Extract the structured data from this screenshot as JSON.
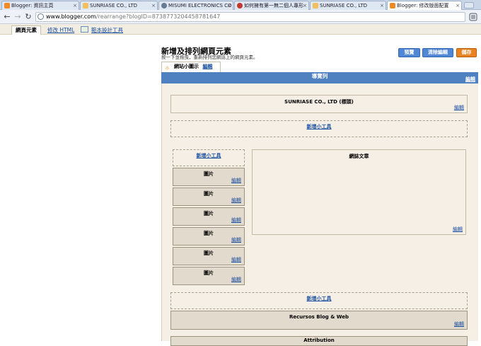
{
  "browser": {
    "tabs": [
      {
        "label": "Blogger: 資訊主頁",
        "color": "#f08a24"
      },
      {
        "label": "SUNRIASE CO., LTD",
        "color": "#f0c060"
      },
      {
        "label": "MISUMI ELECTRONICS CO",
        "color": "#6a7c93"
      },
      {
        "label": "如何擁有第一無二個人專形",
        "color": "#c0392b"
      },
      {
        "label": "SUNRIASE CO., LTD",
        "color": "#f0c060"
      },
      {
        "label": "Blogger: 修改版面配置",
        "color": "#f08a24"
      }
    ],
    "url_host": "www.blogger.com",
    "url_path": "/rearrange?blogID=8738773204458781647"
  },
  "subnav": {
    "page_elements": "網頁元素",
    "edit_html": "修改 HTML",
    "template_designer": "範本設計工具"
  },
  "editor": {
    "title": "新增及排列網頁元素",
    "subtitle": "按一下並拖曳，重新排列您網誌上的網頁元素。",
    "preview": "預覽",
    "clear": "清除編輯",
    "save": "儲存",
    "favicon_label": "網站小圖示",
    "edit": "編輯",
    "navbar": "導覽列",
    "header_gadget": "SUNRIASE CO., LTD (標頭)",
    "add_gadget": "新增小工具",
    "blog_posts": "網誌文章",
    "image": "圖片",
    "recursos": "Recursos Blog & Web",
    "attribution": "Attribution"
  }
}
